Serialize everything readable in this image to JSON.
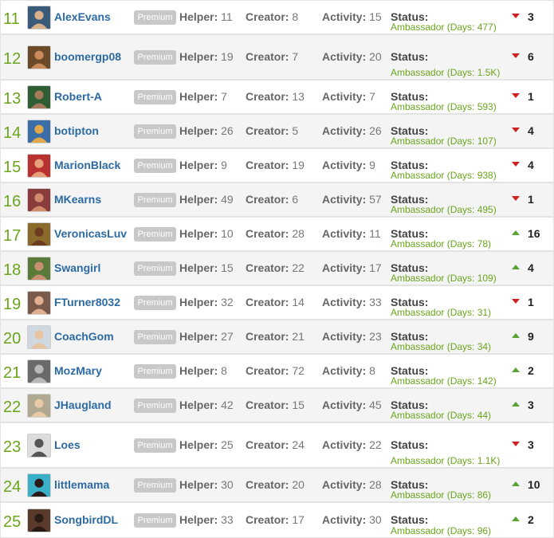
{
  "leaderboard": {
    "labels": {
      "helper": "Helper:",
      "creator": "Creator:",
      "activity": "Activity:",
      "status": "Status:"
    },
    "colors": {
      "rank": "#6aa51c",
      "username": "#2c6aa3",
      "badge": "#c8c8c8",
      "ambassador": "#6aa51c",
      "trend_down": "#d21f1f",
      "trend_up": "#5aa332"
    },
    "rows": [
      {
        "rank": "11",
        "username": "AlexEvans",
        "badge": "Premium",
        "helper": "11",
        "creator": "8",
        "activity": "15",
        "ambassador": "Ambassador (Days: 477)",
        "trend": "down",
        "change": "3"
      },
      {
        "rank": "12",
        "username": "boomergp08",
        "badge": "Premium",
        "helper": "19",
        "creator": "7",
        "activity": "20",
        "ambassador": "Ambassador (Days: 1.5K)",
        "trend": "down",
        "change": "6"
      },
      {
        "rank": "13",
        "username": "Robert-A",
        "badge": "Premium",
        "helper": "7",
        "creator": "13",
        "activity": "7",
        "ambassador": "Ambassador (Days: 593)",
        "trend": "down",
        "change": "1"
      },
      {
        "rank": "14",
        "username": "botipton",
        "badge": "Premium",
        "helper": "26",
        "creator": "5",
        "activity": "26",
        "ambassador": "Ambassador (Days: 107)",
        "trend": "down",
        "change": "4"
      },
      {
        "rank": "15",
        "username": "MarionBlack",
        "badge": "Premium",
        "helper": "9",
        "creator": "19",
        "activity": "9",
        "ambassador": "Ambassador (Days: 938)",
        "trend": "down",
        "change": "4"
      },
      {
        "rank": "16",
        "username": "MKearns",
        "badge": "Premium",
        "helper": "49",
        "creator": "6",
        "activity": "57",
        "ambassador": "Ambassador (Days: 495)",
        "trend": "down",
        "change": "1"
      },
      {
        "rank": "17",
        "username": "VeronicasLuv",
        "badge": "Premium",
        "helper": "10",
        "creator": "28",
        "activity": "11",
        "ambassador": "Ambassador (Days: 78)",
        "trend": "up",
        "change": "16"
      },
      {
        "rank": "18",
        "username": "Swangirl",
        "badge": "Premium",
        "helper": "15",
        "creator": "22",
        "activity": "17",
        "ambassador": "Ambassador (Days: 109)",
        "trend": "up",
        "change": "4"
      },
      {
        "rank": "19",
        "username": "FTurner8032",
        "badge": "Premium",
        "helper": "32",
        "creator": "14",
        "activity": "33",
        "ambassador": "Ambassador (Days: 31)",
        "trend": "down",
        "change": "1"
      },
      {
        "rank": "20",
        "username": "CoachGom",
        "badge": "Premium",
        "helper": "27",
        "creator": "21",
        "activity": "23",
        "ambassador": "Ambassador (Days: 34)",
        "trend": "up",
        "change": "9"
      },
      {
        "rank": "21",
        "username": "MozMary",
        "badge": "Premium",
        "helper": "8",
        "creator": "72",
        "activity": "8",
        "ambassador": "Ambassador (Days: 142)",
        "trend": "up",
        "change": "2"
      },
      {
        "rank": "22",
        "username": "JHaugland",
        "badge": "Premium",
        "helper": "42",
        "creator": "15",
        "activity": "45",
        "ambassador": "Ambassador (Days: 44)",
        "trend": "up",
        "change": "3"
      },
      {
        "rank": "23",
        "username": "Loes",
        "badge": "Premium",
        "helper": "25",
        "creator": "24",
        "activity": "22",
        "ambassador": "Ambassador (Days: 1.1K)",
        "trend": "down",
        "change": "3"
      },
      {
        "rank": "24",
        "username": "littlemama",
        "badge": "Premium",
        "helper": "30",
        "creator": "20",
        "activity": "28",
        "ambassador": "Ambassador (Days: 86)",
        "trend": "up",
        "change": "10"
      },
      {
        "rank": "25",
        "username": "SongbirdDL",
        "badge": "Premium",
        "helper": "33",
        "creator": "17",
        "activity": "30",
        "ambassador": "Ambassador (Days: 96)",
        "trend": "up",
        "change": "2"
      }
    ]
  }
}
